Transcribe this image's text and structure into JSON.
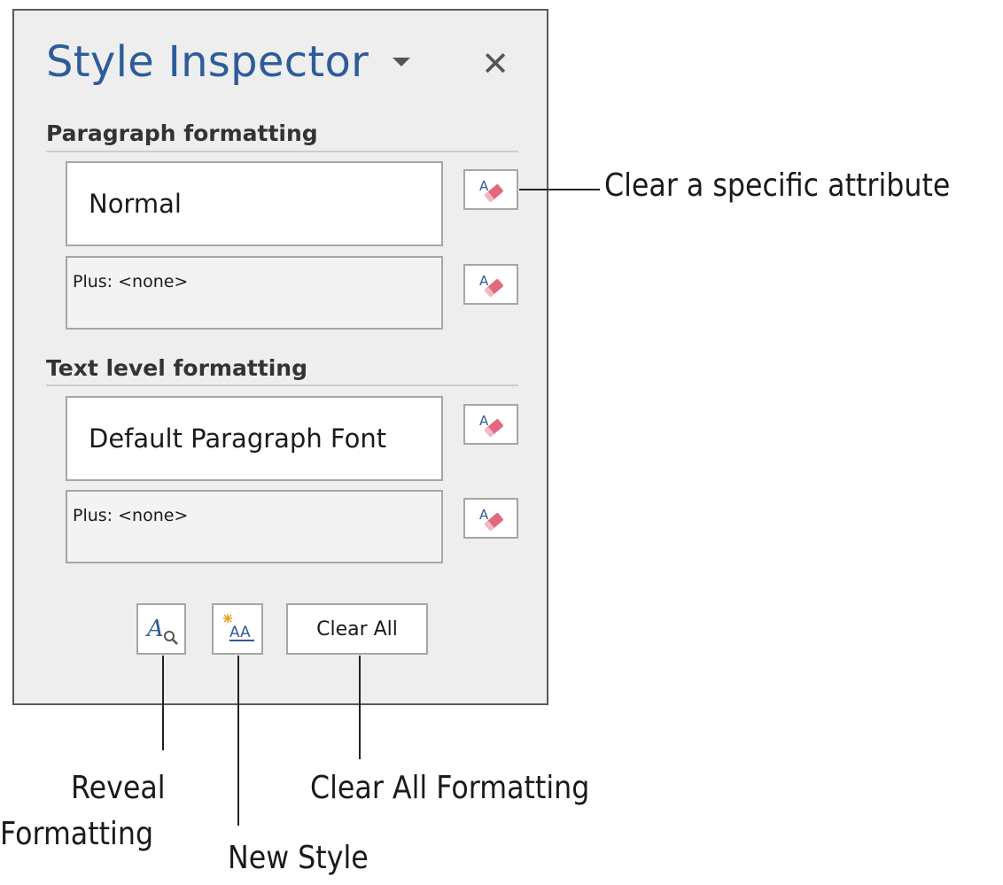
{
  "panel": {
    "title": "Style Inspector",
    "title_dropdown_icon": "triangle-down-icon",
    "close_label": "✕"
  },
  "paragraph_formatting": {
    "heading": "Paragraph formatting",
    "style_value": "Normal",
    "plus_value": "Plus: <none>"
  },
  "text_level_formatting": {
    "heading": "Text level formatting",
    "style_value": "Default Paragraph Font",
    "plus_value": "Plus: <none>"
  },
  "toolbar": {
    "reveal_icon": "reveal-formatting-icon",
    "new_style_icon": "new-style-icon",
    "clear_all_label": "Clear All"
  },
  "callouts": {
    "clear_attribute": "Clear a specific attribute",
    "reveal_formatting_line1": "Reveal",
    "reveal_formatting_line2": "Formatting",
    "new_style": "New Style",
    "clear_all_formatting": "Clear All Formatting"
  },
  "colors": {
    "title_blue": "#2e5c9a",
    "eraser_pink": "#e06a7c",
    "pane_bg": "#eeeeee"
  }
}
